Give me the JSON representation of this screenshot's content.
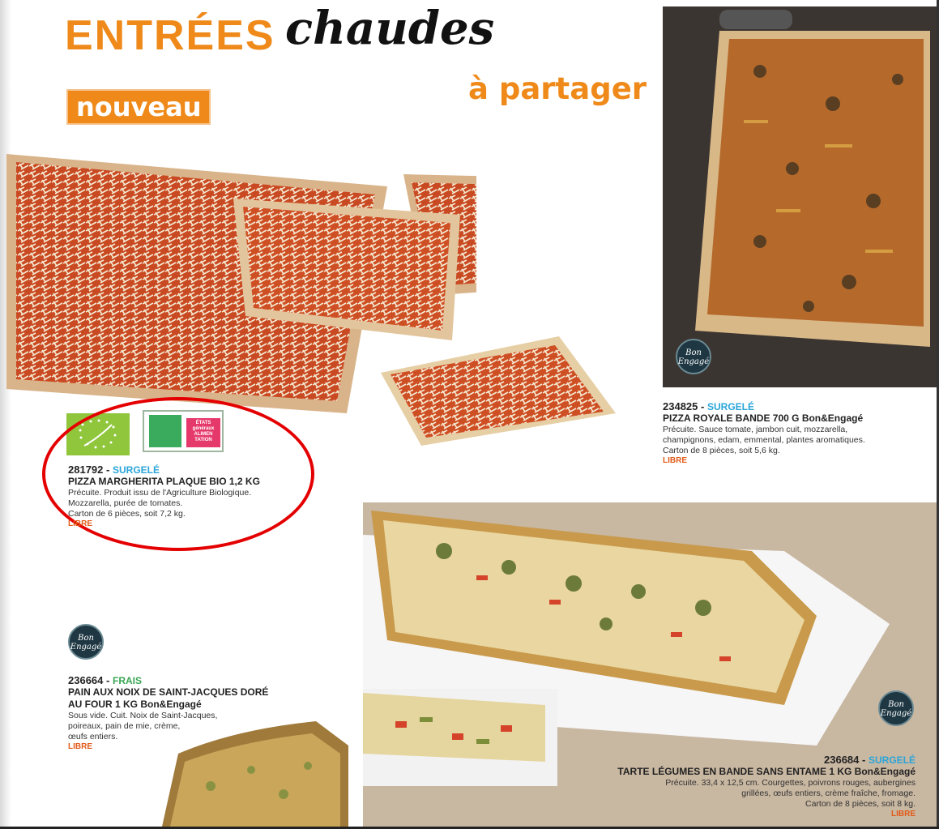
{
  "header": {
    "title_main": "ENTRÉES",
    "title_script": "chaudes",
    "subtitle": "à partager",
    "badge": "nouveau"
  },
  "logos": {
    "eu_organic": "eu-organic-leaf-logo",
    "etats_generaux": "ÉTATS généraux ALIMEN TATION",
    "bon_engage": "Bon Engagé"
  },
  "products": [
    {
      "code": "281792",
      "category": "SURGELÉ",
      "name": "PIZZA MARGHERITA PLAQUE BIO 1,2 KG",
      "description": [
        "Précuite. Produit issu de l'Agriculture Biologique.",
        "Mozzarella, purée de tomates.",
        "Carton de 6 pièces, soit 7,2 kg."
      ],
      "status": "LIBRE"
    },
    {
      "code": "234825",
      "category": "SURGELÉ",
      "name": "PIZZA ROYALE BANDE 700 G Bon&Engagé",
      "description": [
        "Précuite. Sauce tomate, jambon cuit, mozzarella,",
        "champignons, edam, emmental, plantes aromatiques.",
        "Carton de 8 pièces, soit 5,6 kg."
      ],
      "status": "LIBRE"
    },
    {
      "code": "236664",
      "category": "FRAIS",
      "name": [
        "PAIN AUX NOIX DE SAINT-JACQUES DORÉ",
        "AU FOUR 1 KG Bon&Engagé"
      ],
      "description": [
        "Sous vide. Cuit. Noix de Saint-Jacques,",
        "poireaux, pain de mie, crème,",
        "œufs entiers."
      ],
      "status": "LIBRE"
    },
    {
      "code": "236684",
      "category": "SURGELÉ",
      "name": "TARTE LÉGUMES EN BANDE SANS ENTAME 1 KG Bon&Engagé",
      "description": [
        "Précuite. 33,4 x 12,5 cm. Courgettes, poivrons rouges, aubergines",
        "grillées, œufs entiers, crème fraîche, fromage.",
        "Carton de 8 pièces, soit 8 kg."
      ],
      "status": "LIBRE"
    }
  ],
  "colors": {
    "brand_orange": "#ef8a1a",
    "surgele_blue": "#2aa5d9",
    "frais_green": "#3aa654",
    "highlight_red": "#e40000",
    "libre_orange": "#e25a18"
  }
}
